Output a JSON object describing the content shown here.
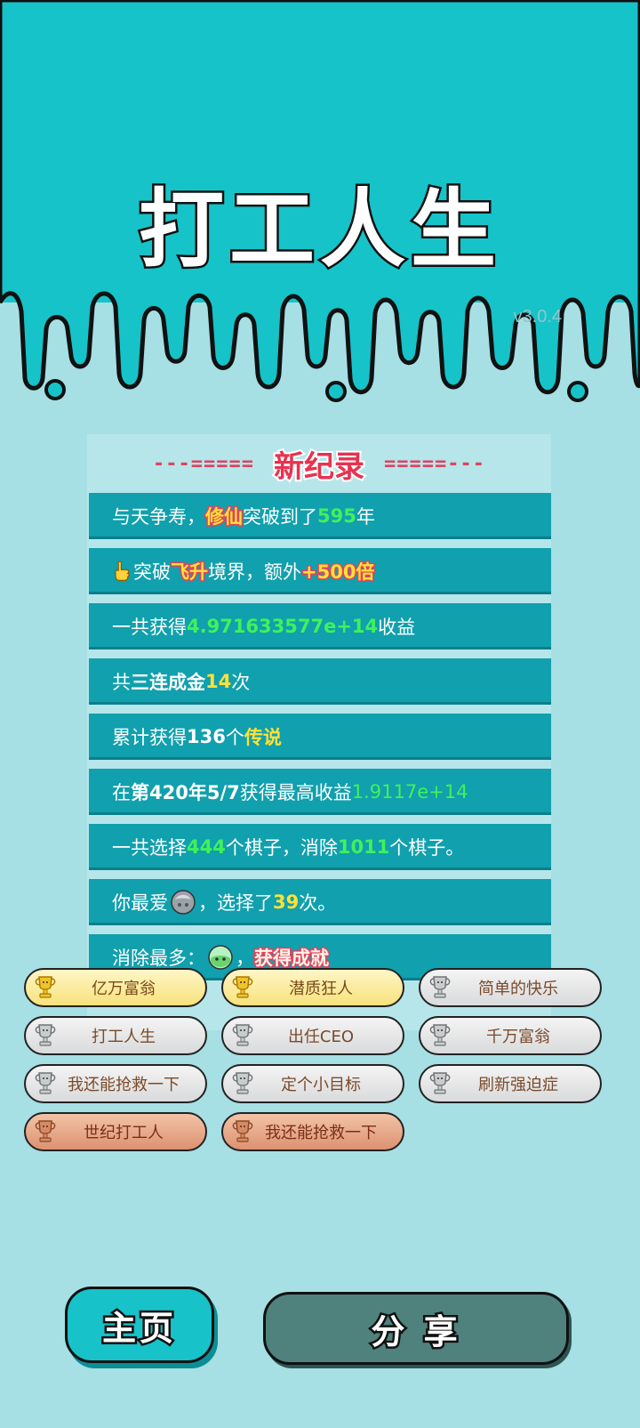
{
  "app": {
    "title": "打工人生",
    "version": "v3.0.4"
  },
  "record": {
    "dashes_left": "---=====",
    "title": "新纪录",
    "dashes_right": "=====---"
  },
  "rows": {
    "r1": {
      "a": "与天争寿，",
      "b": "修仙",
      "c": "突破到了",
      "d": "595",
      "e": "年"
    },
    "r2": {
      "a": "突破 ",
      "b": "飞升",
      "c": "境界，额外",
      "d": "+500倍",
      "icon": "pointing-hand-icon"
    },
    "r3": {
      "a": "一共获得",
      "b": "4.971633577e+14",
      "c": "收益"
    },
    "r4": {
      "a": "共",
      "b": "三连成金",
      "c": "14",
      "d": "次"
    },
    "r5": {
      "a": "累计获得",
      "b": "136",
      "c": "个",
      "d": "传说"
    },
    "r6": {
      "a": "在 ",
      "b": "第420年5/7",
      "c": " 获得最高收益",
      "d": "1.9117e+14"
    },
    "r7": {
      "a": "一共选择",
      "b": "444",
      "c": "个棋子，消除",
      "d": "1011",
      "e": "个棋子。"
    },
    "r8": {
      "a": "你最爱",
      "b": "，选择了",
      "c": "39",
      "d": "次。",
      "icon": "gray-orb-icon"
    },
    "r9": {
      "a": "消除最多：",
      "b": "，",
      "c": "获得成就",
      "icon": "green-orb-icon"
    }
  },
  "achievements": [
    {
      "label": "亿万富翁",
      "tier": "gold"
    },
    {
      "label": "潜质狂人",
      "tier": "gold"
    },
    {
      "label": "简单的快乐",
      "tier": "silver"
    },
    {
      "label": "打工人生",
      "tier": "silver"
    },
    {
      "label": "出任CEO",
      "tier": "silver"
    },
    {
      "label": "千万富翁",
      "tier": "silver"
    },
    {
      "label": "我还能抢救一下",
      "tier": "silver"
    },
    {
      "label": "定个小目标",
      "tier": "silver"
    },
    {
      "label": "刷新强迫症",
      "tier": "silver"
    },
    {
      "label": "世纪打工人",
      "tier": "bronze"
    },
    {
      "label": "我还能抢救一下",
      "tier": "bronze"
    }
  ],
  "buttons": {
    "home": "主页",
    "share": "分 享"
  },
  "colors": {
    "teal": "#16c3c8",
    "row": "#11a0ad",
    "green": "#3ff25a",
    "yellow": "#ffe136",
    "red": "#e0425f"
  }
}
